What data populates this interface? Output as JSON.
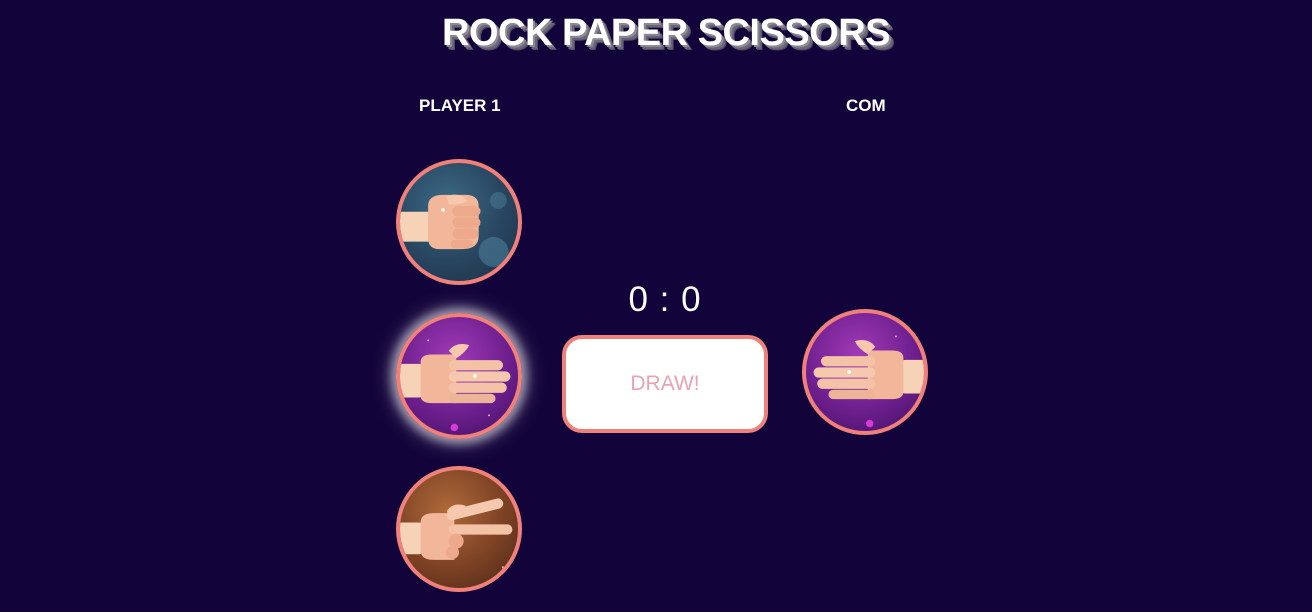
{
  "title": "ROCK PAPER SCISSORS",
  "players": {
    "player1_label": "PLAYER 1",
    "com_label": "COM"
  },
  "choices": [
    {
      "id": "rock",
      "icon": "rock-fist-icon",
      "selected": false
    },
    {
      "id": "paper",
      "icon": "paper-hand-icon",
      "selected": true
    },
    {
      "id": "scissors",
      "icon": "scissors-hand-icon",
      "selected": false
    }
  ],
  "com_choice": {
    "id": "paper",
    "icon": "paper-hand-icon"
  },
  "score": "0 : 0",
  "result": "DRAW!",
  "colors": {
    "background": "#12033a",
    "accent_border": "#f0807a",
    "result_text": "#e8a3b3"
  }
}
